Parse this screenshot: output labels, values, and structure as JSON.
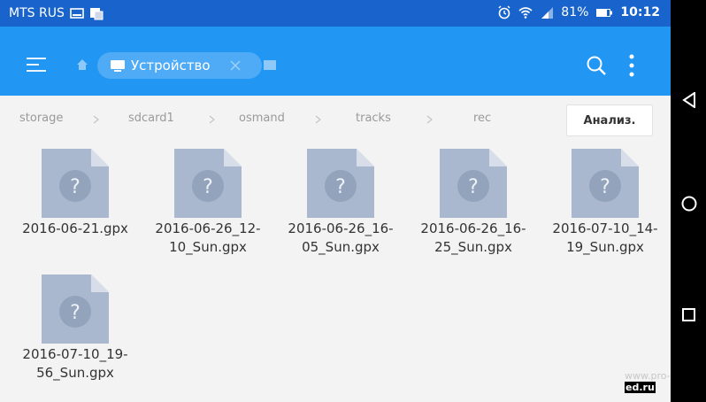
{
  "status_bar": {
    "carrier": "MTS RUS",
    "battery": "81%",
    "time": "10:12"
  },
  "toolbar": {
    "tab_label": "Устройство",
    "accent_color": "#2196f3",
    "status_color": "#1864cc"
  },
  "breadcrumb": [
    "storage",
    "sdcard1",
    "osmand",
    "tracks",
    "rec"
  ],
  "analyze_label": "Анализ.",
  "files": [
    {
      "name": "2016-06-21.gpx"
    },
    {
      "name": "2016-06-26_12-\n10_Sun.gpx"
    },
    {
      "name": "2016-06-26_16-\n05_Sun.gpx"
    },
    {
      "name": "2016-06-26_16-\n25_Sun.gpx"
    },
    {
      "name": "2016-07-10_14-\n19_Sun.gpx"
    },
    {
      "name": "2016-07-10_19-\n56_Sun.gpx"
    }
  ],
  "icons": {
    "file": "unknown-file-icon",
    "menu": "hamburger-menu-icon",
    "search": "search-icon",
    "more": "more-vertical-icon"
  },
  "watermark": {
    "text": "www.pro-",
    "highlight": "ed.ru"
  }
}
